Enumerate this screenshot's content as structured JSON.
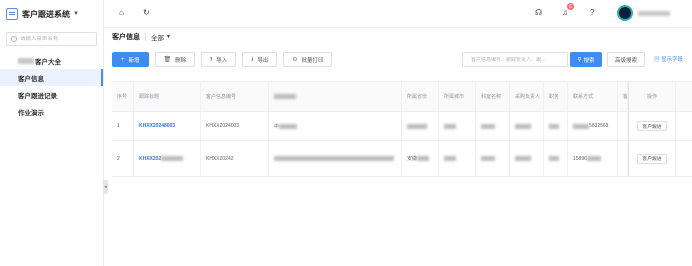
{
  "app": {
    "title": "客户跟进系统"
  },
  "sidebar": {
    "search_placeholder": "请输入菜单名称",
    "items": [
      {
        "label": "客户大全"
      },
      {
        "label": "客户信息"
      },
      {
        "label": "客户跟进记录"
      },
      {
        "label": "作业演示"
      }
    ]
  },
  "topbar": {
    "badge_count": "6"
  },
  "page": {
    "title": "客户信息",
    "scope": "全部"
  },
  "toolbar": {
    "add": "新增",
    "delete": "删除",
    "import": "导入",
    "export": "导出",
    "batch_print": "批量打印",
    "search_placeholder": "客户信息编号、跟踪负责人、跟...",
    "search": "搜索",
    "advanced_search": "高级搜索",
    "show_fields": "显示字段"
  },
  "table": {
    "headers": [
      "序号",
      "跟踪标题",
      "客户信息编号",
      "",
      "所属省份",
      "所属城市",
      "科室名称",
      "采购负责人",
      "职务",
      "联系方式",
      "客",
      "操作"
    ],
    "rows": [
      {
        "index": "1",
        "title": "KHXX20248003",
        "code": "KHXX2024003",
        "name": "中",
        "phone": "5632563",
        "op": "客户跟进"
      },
      {
        "index": "2",
        "title": "KHXX202",
        "code": "KHXX20242",
        "province": "安徽",
        "phone": "15896",
        "op": "客户跟进"
      }
    ]
  }
}
